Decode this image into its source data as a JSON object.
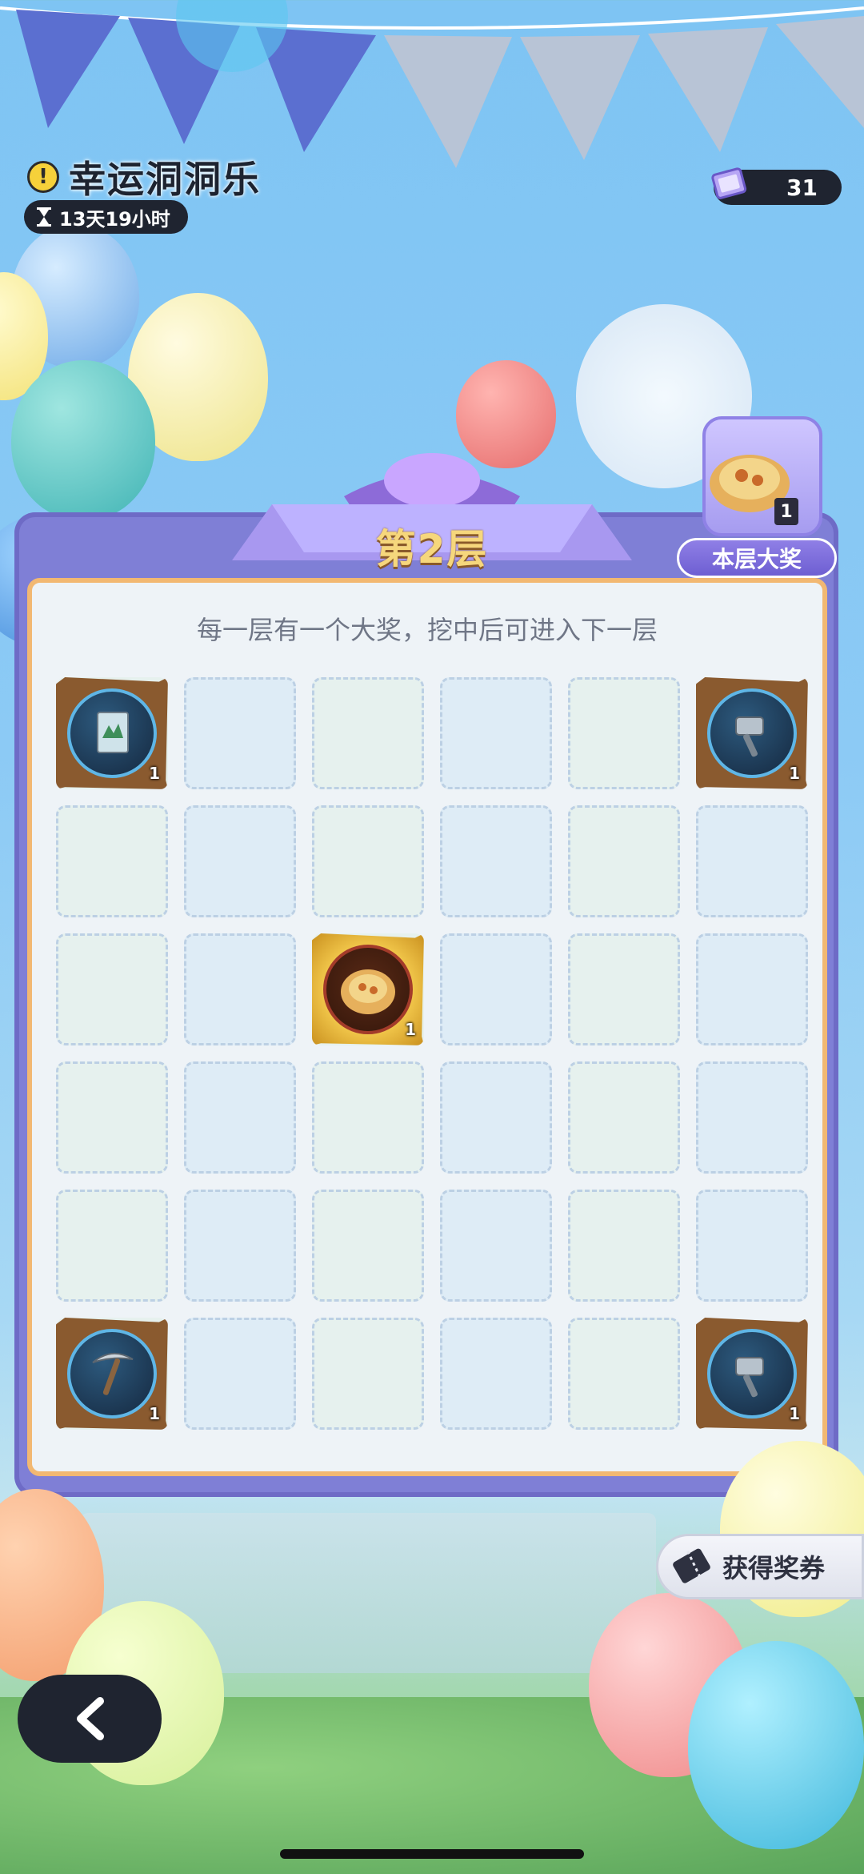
{
  "header": {
    "title": "幸运洞洞乐",
    "timer": "13天19小时",
    "currency_count": "31"
  },
  "board": {
    "floor_label": "第2层",
    "subtitle": "每一层有一个大奖，挖中后可进入下一层",
    "grid": [
      [
        "scroll-map",
        "",
        "",
        "",
        "",
        "hammer"
      ],
      [
        "",
        "",
        "",
        "",
        "",
        ""
      ],
      [
        "",
        "",
        "dish",
        "",
        "",
        ""
      ],
      [
        "",
        "",
        "",
        "",
        "",
        ""
      ],
      [
        "",
        "",
        "",
        "",
        "",
        ""
      ],
      [
        "pickaxe",
        "",
        "",
        "",
        "",
        "hammer"
      ]
    ],
    "item_qty": "1"
  },
  "grand_prize": {
    "label": "本层大奖",
    "qty": "1",
    "icon": "dish-icon"
  },
  "actions": {
    "get_ticket_label": "获得奖券",
    "back_icon": "chevron-left-icon"
  },
  "colors": {
    "sky": "#7ec4f3",
    "board": "#7f7fd6",
    "board_inner": "#eef3f7",
    "gold_text": "#f6d77c"
  }
}
